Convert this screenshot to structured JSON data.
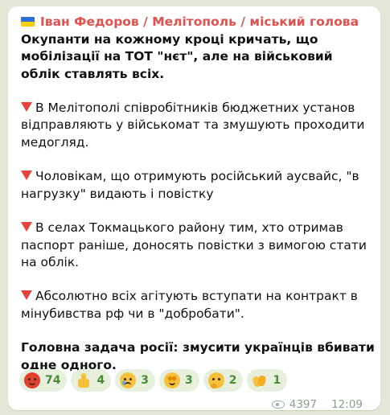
{
  "message": {
    "channel_name": "Іван Федоров / Мелітополь / міський голова",
    "headline": "Окупанти на кожному кроці кричать, що мобілізації на ТОТ \"нєт\", але на військовий облік ставлять всіх.",
    "items": [
      "В Мелітополі співробітників бюджетних установ відправляють у військомат та змушують проходити медогляд.",
      "Чоловікам, що отримують російський аусвайс, \"в нагрузку\" видають і повістку",
      "В селах Токмацького району тим, хто отримав паспорт раніше, доносять повістки з вимогою стати на облік.",
      "Абсолютно всіх агітують вступати на контракт в мінубивства рф чи в \"добробати\"."
    ],
    "conclusion": "Головна задача росії: змусити українців вбивати одне одного.",
    "bullet_icon": "red-triangle-down",
    "reactions": [
      {
        "icon": "angry-face",
        "count": "74"
      },
      {
        "icon": "thumbs-up",
        "count": "4"
      },
      {
        "icon": "crying-face",
        "count": "3"
      },
      {
        "icon": "star-struck-face",
        "count": "3"
      },
      {
        "icon": "thinking-face",
        "count": "2"
      },
      {
        "icon": "clapping-hands",
        "count": "1"
      }
    ],
    "views": "4397",
    "time": "12:09"
  },
  "colors": {
    "background": "#e3e8d6",
    "bubble": "#ffffff",
    "channel_name": "#e0524e",
    "reaction_bg": "#e6f0dc",
    "reaction_text": "#4c8a3a",
    "bullet": "#e8433a",
    "meta": "#8aa08a"
  }
}
